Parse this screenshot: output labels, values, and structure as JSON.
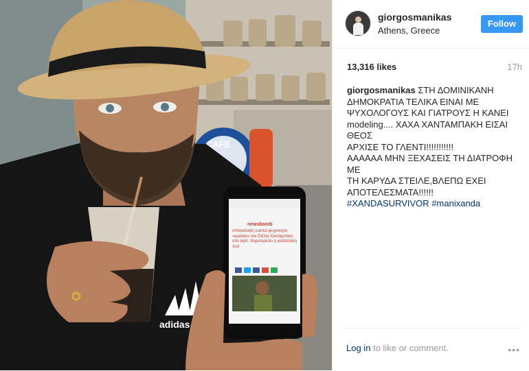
{
  "post": {
    "username": "giorgosmanikas",
    "location": "Athens, Greece",
    "follow_label": "Follow",
    "likes": "13,316 likes",
    "time": "17h",
    "caption_lines": [
      "ΣΤΗ ΔΟΜΙΝΙΚΑΝΗ",
      "ΔΗΜΟΚΡΑΤΙΑ ΤΕΛΙΚΑ ΕΙΝΑΙ ΜΕ",
      "ΨΥΧΟΛΟΓΟΥΣ ΚΑΙ ΓΙΑΤΡΟΥΣ Η ΚΑΝΕΙ",
      "modeling.... ΧΑΧΑ ΧΑΝΤΑΜΠΑΚΗ ΕΙΣΑΙ",
      "ΘΕΟΣ",
      "ΑΡΧΙΣΕ ΤΟ ΓΛΕΝΤΙ!!!!!!!!!!!",
      "ΑΑΑΑΑΑ ΜΗΝ ΞΕΧΑΣΕΙΣ ΤΗ ΔΙΑΤΡΟΦΗ ΜΕ",
      "ΤΗ ΚΑΡΥΔΑ ΣΤΕΙΛΕ,ΒΛΕΠΩ ΕΧΕΙ",
      "ΑΠΟΤΕΛΕΣΜΑΤΑ!!!!!!"
    ],
    "hashtags": [
      "#XANDASURVIVOR",
      "#manixanda"
    ],
    "login_link": "Log in",
    "login_rest": " to like or comment.",
    "more_icon": "•••"
  },
  "photo": {
    "phone_headline": "Αποκάλυψη Σοκ!Οι ψυχολόγοι «κρατάν» τον Στέλιο Χανταμπάκη στο νησί: Χειροτερεύει η κατάσταση του!",
    "phone_logo": "newsbomb",
    "shirt_text": "adidas",
    "sign_text": "CAFE"
  }
}
